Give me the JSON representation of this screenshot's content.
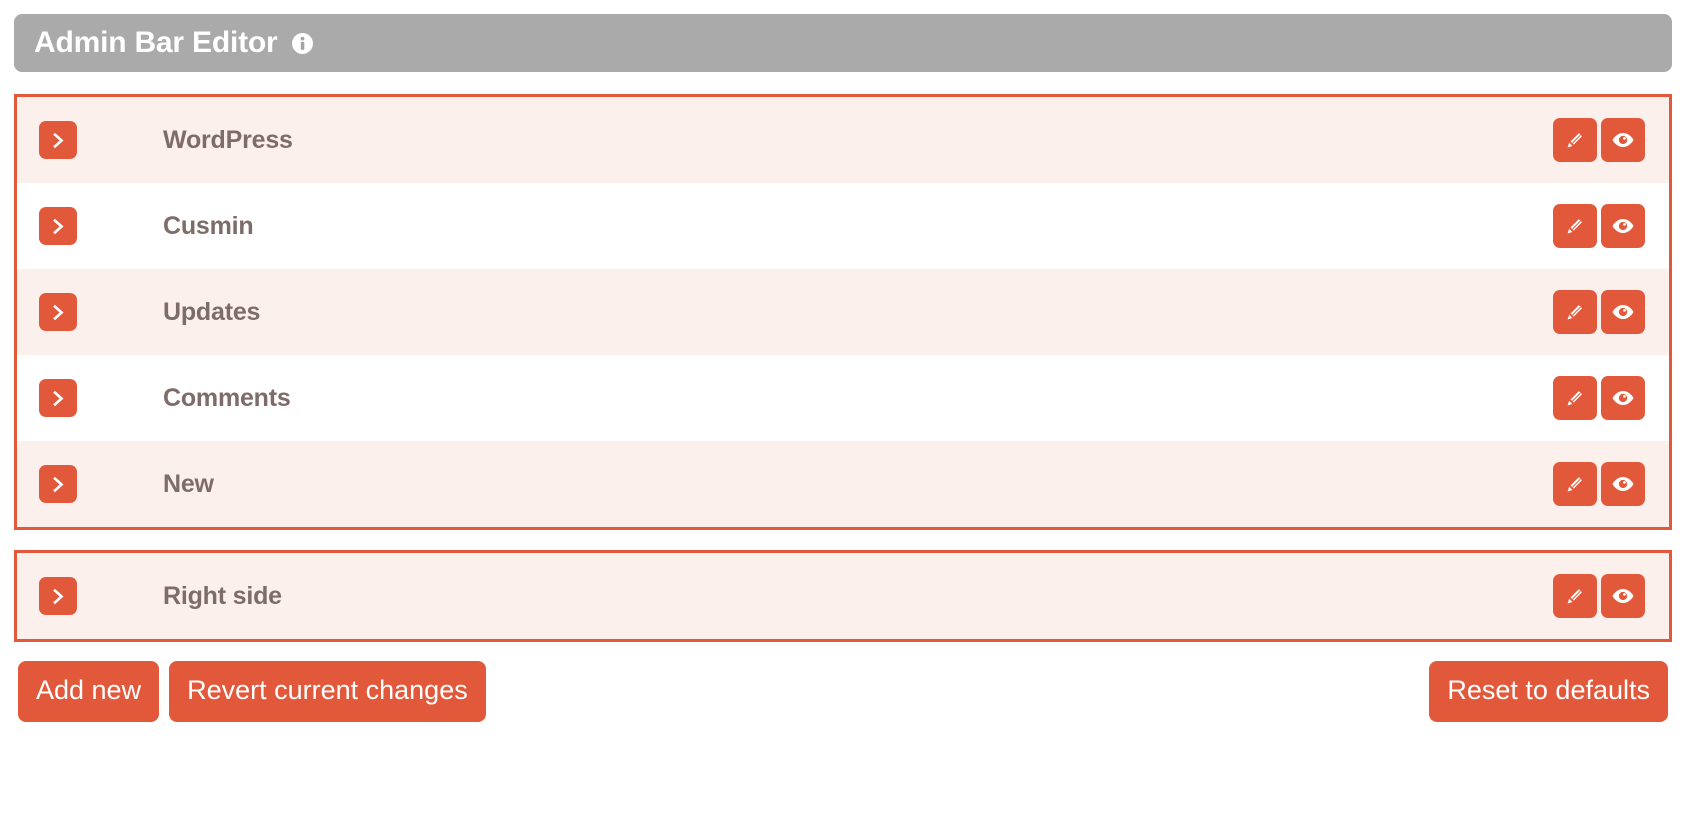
{
  "header": {
    "title": "Admin Bar Editor",
    "info_icon": "info-circle-icon",
    "background_color": "#aaaaaa",
    "text_color": "#ffffff"
  },
  "theme": {
    "accent": "#e2583a",
    "row_shade": "#fcf0ec",
    "row_plain": "#ffffff",
    "label_color": "#7d6c67",
    "border_color": "#e2583a"
  },
  "groups": [
    {
      "name": "left-side-items",
      "rows": [
        {
          "label": "WordPress",
          "expand_icon": "chevron-right-icon",
          "edit_icon": "pencil-icon",
          "visibility_icon": "eye-icon",
          "shaded": true
        },
        {
          "label": "Cusmin",
          "expand_icon": "chevron-right-icon",
          "edit_icon": "pencil-icon",
          "visibility_icon": "eye-icon",
          "shaded": false
        },
        {
          "label": "Updates",
          "expand_icon": "chevron-right-icon",
          "edit_icon": "pencil-icon",
          "visibility_icon": "eye-icon",
          "shaded": true
        },
        {
          "label": "Comments",
          "expand_icon": "chevron-right-icon",
          "edit_icon": "pencil-icon",
          "visibility_icon": "eye-icon",
          "shaded": false
        },
        {
          "label": "New",
          "expand_icon": "chevron-right-icon",
          "edit_icon": "pencil-icon",
          "visibility_icon": "eye-icon",
          "shaded": true
        }
      ]
    },
    {
      "name": "right-side-items",
      "rows": [
        {
          "label": "Right side",
          "expand_icon": "chevron-right-icon",
          "edit_icon": "pencil-icon",
          "visibility_icon": "eye-icon",
          "shaded": true
        }
      ]
    }
  ],
  "footer": {
    "add_new_label": "Add new",
    "revert_label": "Revert current changes",
    "reset_label": "Reset to defaults"
  }
}
